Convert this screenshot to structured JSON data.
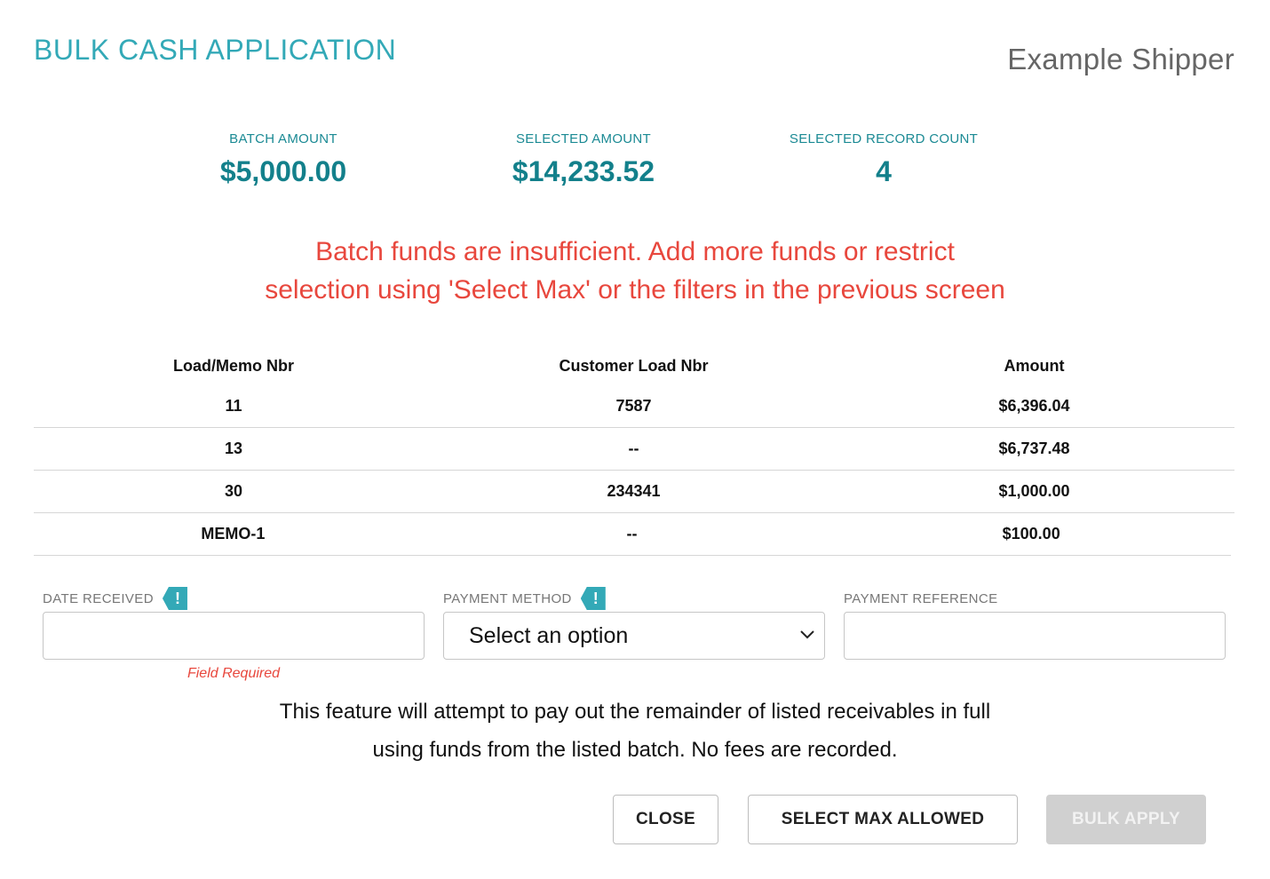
{
  "header": {
    "title": "BULK CASH APPLICATION",
    "company": "Example Shipper"
  },
  "stats": [
    {
      "label": "BATCH AMOUNT",
      "value": "$5,000.00"
    },
    {
      "label": "SELECTED AMOUNT",
      "value": "$14,233.52"
    },
    {
      "label": "SELECTED RECORD COUNT",
      "value": "4"
    }
  ],
  "warning": {
    "line1": "Batch funds are insufficient. Add more funds or restrict",
    "line2": "selection using 'Select Max' or the filters in the previous screen"
  },
  "table": {
    "columns": [
      "Load/Memo Nbr",
      "Customer Load Nbr",
      "Amount"
    ],
    "rows": [
      [
        "11",
        "7587",
        "$6,396.04"
      ],
      [
        "13",
        "--",
        "$6,737.48"
      ],
      [
        "30",
        "234341",
        "$1,000.00"
      ],
      [
        "MEMO-1",
        "--",
        "$100.00"
      ]
    ]
  },
  "form": {
    "date_received": {
      "label": "DATE RECEIVED",
      "flag": "!",
      "value": "",
      "error": "Field Required"
    },
    "payment_method": {
      "label": "PAYMENT METHOD",
      "flag": "!",
      "selected": "Select an option"
    },
    "payment_reference": {
      "label": "PAYMENT REFERENCE",
      "value": ""
    }
  },
  "note": {
    "line1": "This feature will attempt to pay out the remainder of listed receivables in full",
    "line2": "using funds from the listed batch. No fees are recorded."
  },
  "buttons": {
    "close": "CLOSE",
    "select_max": "SELECT MAX ALLOWED",
    "bulk_apply": "BULK APPLY"
  },
  "colors": {
    "accent": "#33a9b7",
    "stat_text": "#13808b",
    "error": "#e8473d",
    "disabled": "#d0d0d0"
  }
}
